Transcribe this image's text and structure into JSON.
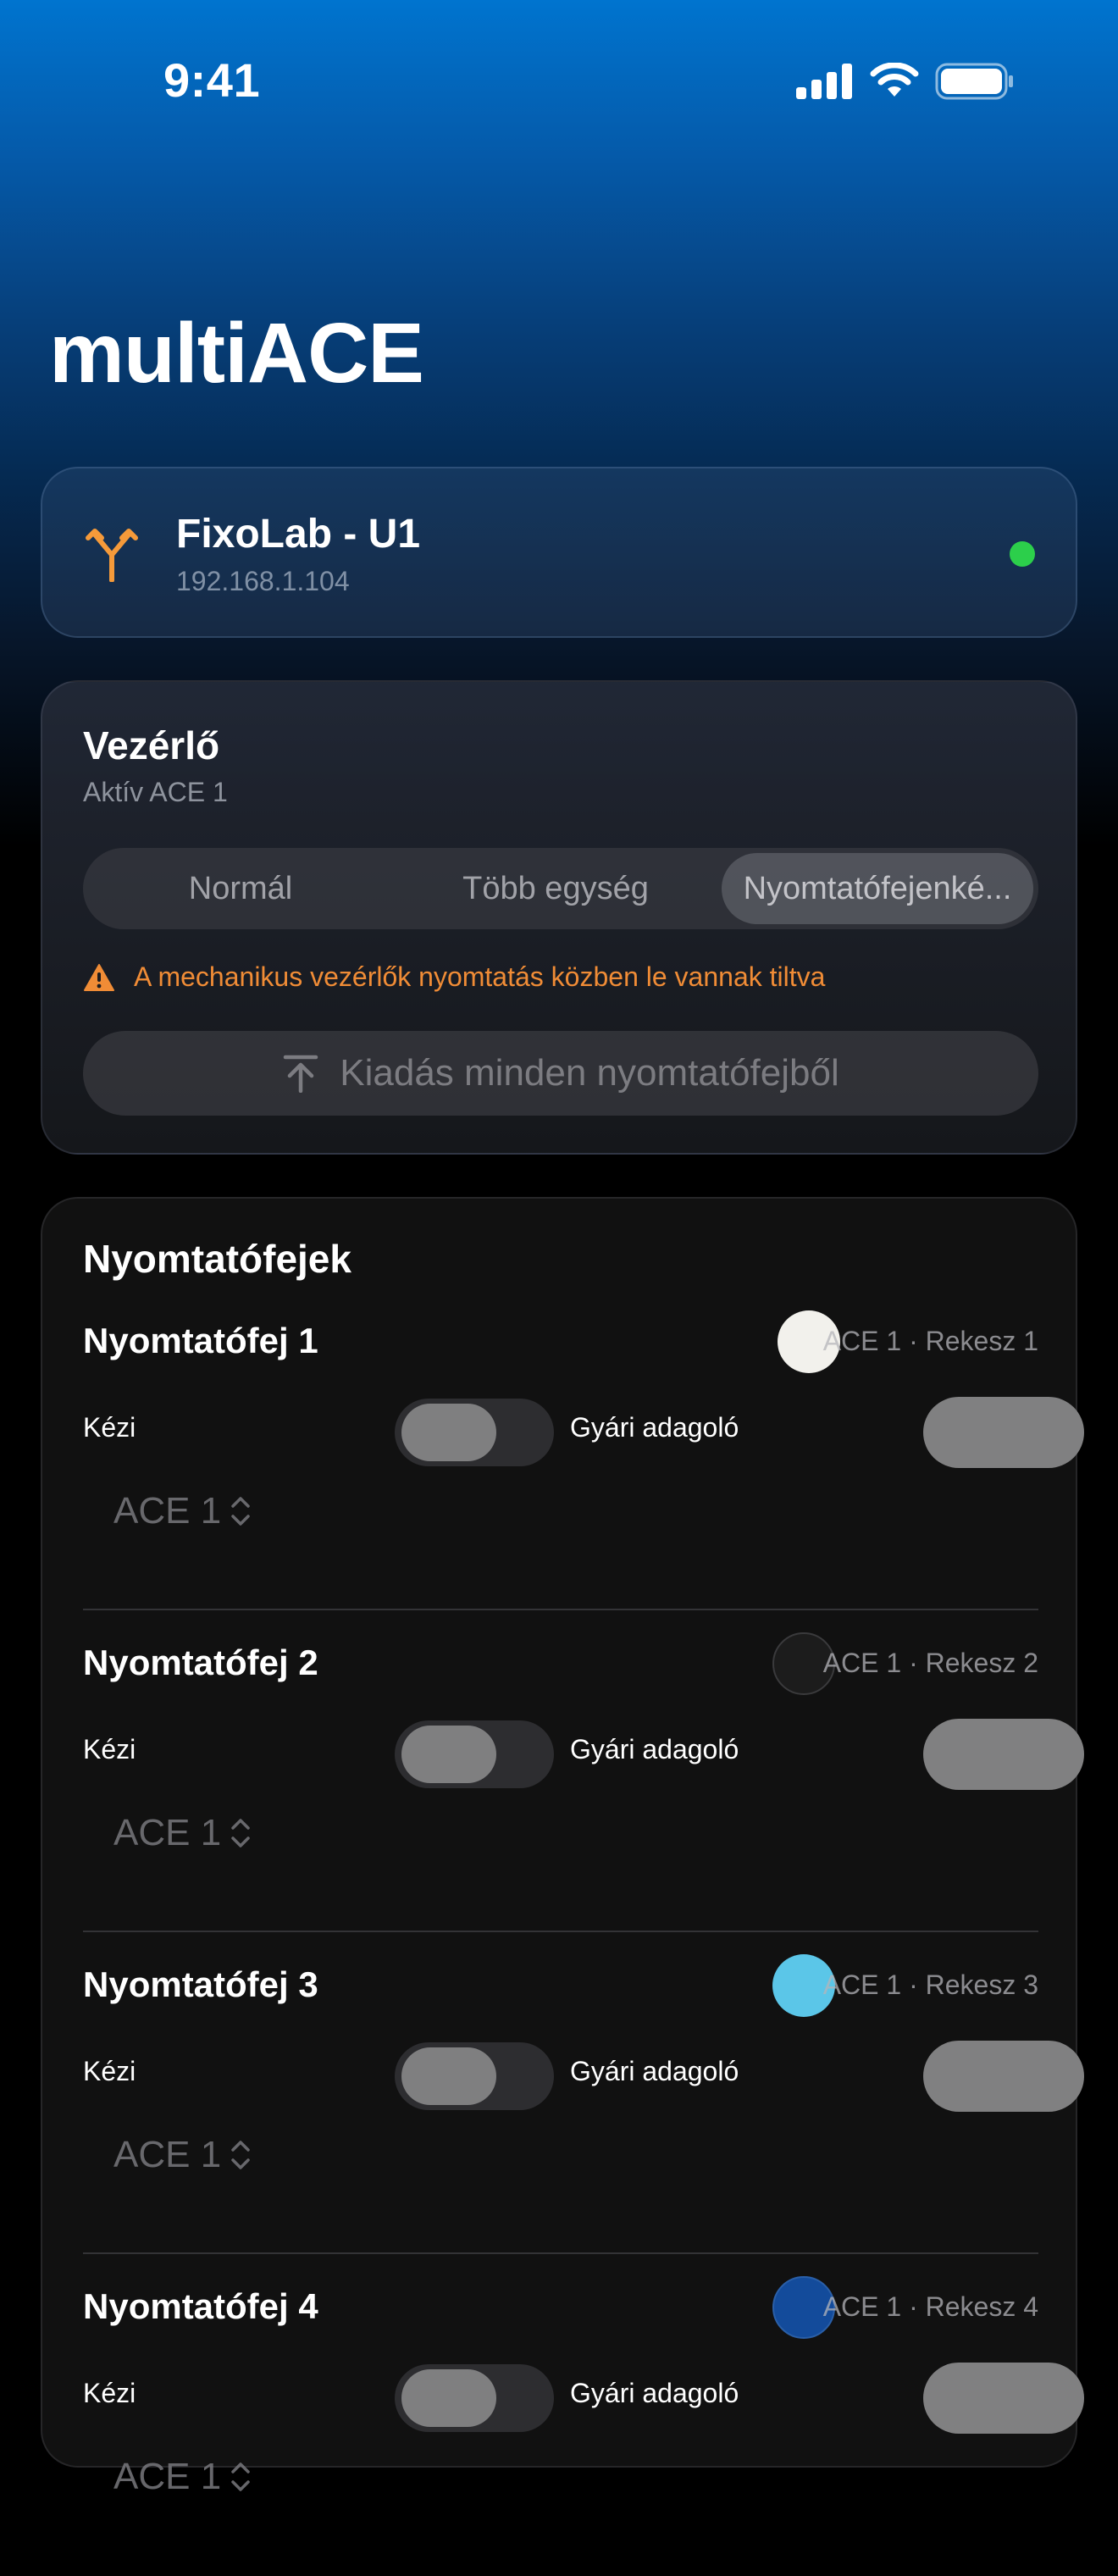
{
  "status_bar": {
    "time": "9:41",
    "icons": [
      "signal-icon",
      "wifi-icon",
      "battery-icon"
    ]
  },
  "app": {
    "title": "multiACE"
  },
  "device": {
    "name": "FixoLab - U1",
    "ip": "192.168.1.104",
    "icon": "fork-icon",
    "status_color": "#2ccf4b"
  },
  "controller": {
    "title": "Vezérlő",
    "subtitle": "Aktív ACE 1",
    "modes": [
      "Normál",
      "Több egység",
      "Nyomtatófejenké..."
    ],
    "selected_mode": "Nyomtatófejenké...",
    "warning": "A mechanikus vezérlők nyomtatás közben le vannak tiltva",
    "eject_button": "Kiadás minden nyomtatófejből",
    "accent_color": "#f08c36"
  },
  "toolheads": {
    "title": "Nyomtatófejek",
    "items": [
      {
        "name": "Nyomtatófej 1",
        "slot": "ACE 1 · Rekesz 1",
        "color": "#f2f1ec",
        "manual_label": "Kézi",
        "manual_on": false,
        "feeder_label": "Gyári adagoló",
        "ace_select": "ACE 1"
      },
      {
        "name": "Nyomtatófej 2",
        "slot": "ACE 1 · Rekesz 2",
        "color": "#1c1c1c",
        "manual_label": "Kézi",
        "manual_on": false,
        "feeder_label": "Gyári adagoló",
        "ace_select": "ACE 1"
      },
      {
        "name": "Nyomtatófej 3",
        "slot": "ACE 1 · Rekesz 3",
        "color": "#5bc6e8",
        "manual_label": "Kézi",
        "manual_on": false,
        "feeder_label": "Gyári adagoló",
        "ace_select": "ACE 1"
      },
      {
        "name": "Nyomtatófej 4",
        "slot": "ACE 1 · Rekesz 4",
        "color": "#134b9b",
        "manual_label": "Kézi",
        "manual_on": false,
        "feeder_label": "Gyári adagoló",
        "ace_select": "ACE 1"
      }
    ]
  }
}
